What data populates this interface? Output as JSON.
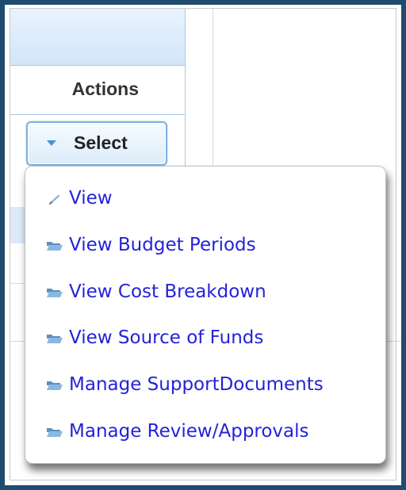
{
  "table": {
    "actions_header": "Actions",
    "select_button_label": "Select"
  },
  "menu": {
    "items": [
      {
        "label": "View",
        "icon": "pencil-icon"
      },
      {
        "label": "View Budget Periods",
        "icon": "folder-icon"
      },
      {
        "label": "View Cost Breakdown",
        "icon": "folder-icon"
      },
      {
        "label": "View Source of Funds",
        "icon": "folder-icon"
      },
      {
        "label": "Manage SupportDocuments",
        "icon": "folder-icon"
      },
      {
        "label": "Manage Review/Approvals",
        "icon": "folder-icon"
      }
    ]
  },
  "colors": {
    "frame_border": "#1f4b6e",
    "header_band": "#d2e6f8",
    "menu_link": "#2323d9",
    "icon": "#6ea2cc"
  }
}
